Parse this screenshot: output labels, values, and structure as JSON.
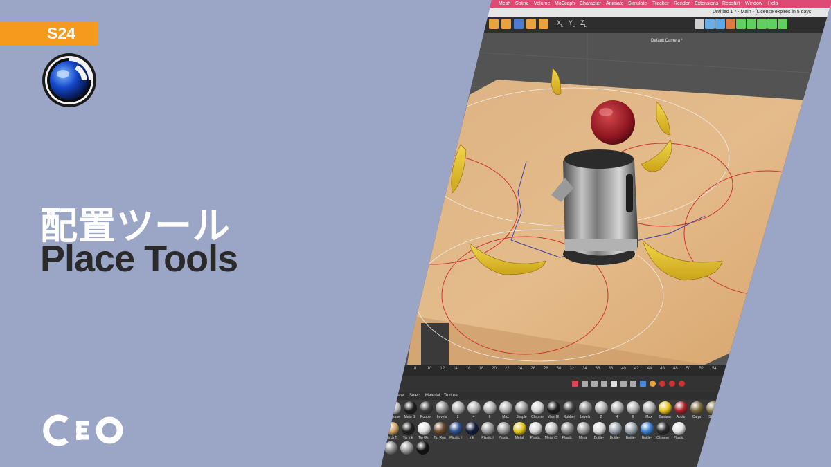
{
  "badge": {
    "text": "S24"
  },
  "title": {
    "jp": "配置ツール",
    "en": "Place Tools"
  },
  "app": {
    "menu": [
      "Mesh",
      "Spline",
      "Volume",
      "MoGraph",
      "Character",
      "Animate",
      "Simulate",
      "Tracker",
      "Render",
      "Extensions",
      "Redshift",
      "Window",
      "Help"
    ],
    "window_title": "Untitled 1 * - Main - [License expires in 5 days",
    "toolbar_left": [
      {
        "icon": "undo-icon",
        "color": "#e8a33d"
      },
      {
        "icon": "cube-icon",
        "color": "#e8a33d"
      },
      {
        "icon": "place-tool-icon",
        "color": "#4f7cd1"
      },
      {
        "icon": "dynamic-place-icon",
        "color": "#e8a33d"
      },
      {
        "icon": "scatter-place-icon",
        "color": "#e8a33d"
      }
    ],
    "axes": [
      {
        "letter": "X",
        "sub": "L"
      },
      {
        "letter": "Y",
        "sub": "L"
      },
      {
        "letter": "Z",
        "sub": "L"
      }
    ],
    "toolbar_right": [
      {
        "icon": "render-view-icon",
        "color": "#cfcfcf"
      },
      {
        "icon": "perspective-icon",
        "color": "#6aaee8"
      },
      {
        "icon": "primitive-cube-icon",
        "color": "#5da8e8"
      },
      {
        "icon": "pen-icon",
        "color": "#e07a3c"
      },
      {
        "icon": "generator-icon",
        "color": "#5fcf5f"
      },
      {
        "icon": "deformer-icon",
        "color": "#5fcf5f"
      },
      {
        "icon": "mograph-icon",
        "color": "#5fcf5f"
      },
      {
        "icon": "field-icon",
        "color": "#5fcf5f"
      },
      {
        "icon": "cloner-icon",
        "color": "#5fcf5f"
      }
    ],
    "viewport": {
      "camera_label": "Default Camera *"
    },
    "timeline": [
      "8",
      "10",
      "12",
      "14",
      "16",
      "18",
      "20",
      "22",
      "24",
      "26",
      "28",
      "30",
      "32",
      "34",
      "36",
      "38",
      "40",
      "42",
      "44",
      "46",
      "48",
      "50",
      "52",
      "54"
    ],
    "material_menu": [
      "View",
      "Select",
      "Material",
      "Texture"
    ],
    "materials_row1": [
      {
        "label": "Chrome",
        "color": "#c9c9c9"
      },
      {
        "label": "Main Bl",
        "color": "#1e1e1e"
      },
      {
        "label": "Rubber",
        "color": "#3d3d3d"
      },
      {
        "label": "Levels",
        "color": "#8a8a8a"
      },
      {
        "label": "2",
        "color": "#b0b0b0"
      },
      {
        "label": "4",
        "color": "#b0b0b0"
      },
      {
        "label": "6",
        "color": "#b0b0b0"
      },
      {
        "label": "Max",
        "color": "#b0b0b0"
      },
      {
        "label": "Simple",
        "color": "#9a9a9a"
      },
      {
        "label": "Chrome",
        "color": "#d4d4d4"
      },
      {
        "label": "Main Bl",
        "color": "#1e1e1e"
      },
      {
        "label": "Rubber",
        "color": "#3d3d3d"
      },
      {
        "label": "Levels",
        "color": "#8a8a8a"
      },
      {
        "label": "2",
        "color": "#b0b0b0"
      },
      {
        "label": "4",
        "color": "#b0b0b0"
      },
      {
        "label": "6",
        "color": "#b0b0b0"
      },
      {
        "label": "Max",
        "color": "#b0b0b0"
      },
      {
        "label": "Banana",
        "color": "#e8c31d"
      },
      {
        "label": "Apple",
        "color": "#b0202a"
      },
      {
        "label": "Calyx",
        "color": "#7a6a3a"
      },
      {
        "label": "Stem",
        "color": "#8a7a4a"
      }
    ],
    "materials_row2": [
      {
        "label": "Birch Ti",
        "color": "#d7a769"
      },
      {
        "label": "Tip Ink",
        "color": "#202020"
      },
      {
        "label": "Tip Glo",
        "color": "#e2e2e2"
      },
      {
        "label": "Tip Rou",
        "color": "#6d4a2a"
      },
      {
        "label": "Plastic I",
        "color": "#2c4f8c"
      },
      {
        "label": "Ink",
        "color": "#101c3a"
      },
      {
        "label": "Plastic I",
        "color": "#9a9a9a"
      },
      {
        "label": "Plastic",
        "color": "#9a9a9a"
      },
      {
        "label": "Metal",
        "color": "#e2c41a"
      },
      {
        "label": "Plastic",
        "color": "#d8d8d8"
      },
      {
        "label": "Metal (S",
        "color": "#bdbdbd"
      },
      {
        "label": "Plastic",
        "color": "#8c8c8c"
      },
      {
        "label": "Metal",
        "color": "#9c9c9c"
      },
      {
        "label": "Bottle-",
        "color": "#dcdcdc"
      },
      {
        "label": "Bottle-",
        "color": "#9aa3ad"
      },
      {
        "label": "Bottle-",
        "color": "#9aa3ad"
      },
      {
        "label": "Bottle-",
        "color": "#3a7fd1"
      },
      {
        "label": "Chrome",
        "color": "#2a2a2a"
      },
      {
        "label": "Plastic",
        "color": "#e4e4e4"
      }
    ],
    "materials_row3": [
      {
        "label": "",
        "color": "#8a8a8a"
      },
      {
        "label": "",
        "color": "#9c9c9c"
      },
      {
        "label": "",
        "color": "#111111"
      }
    ]
  }
}
